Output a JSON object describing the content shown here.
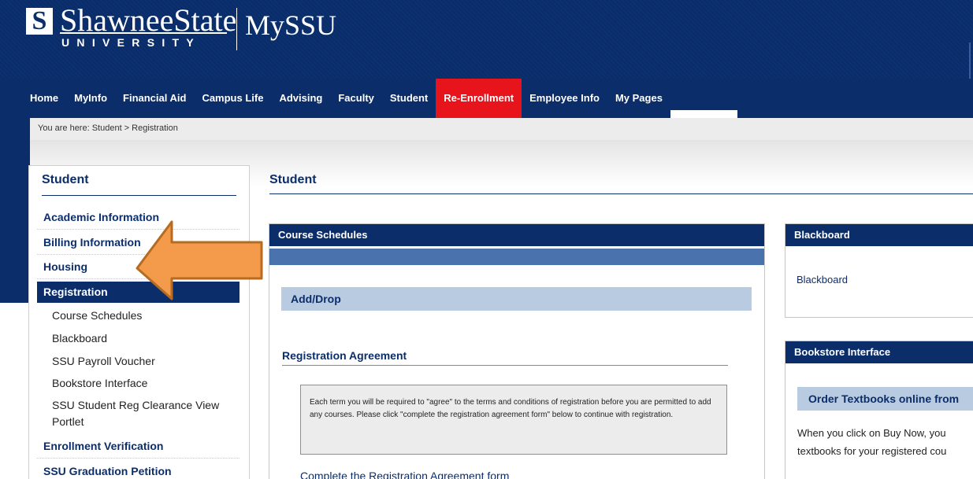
{
  "header": {
    "logo_mark": "S",
    "logo_name": "ShawneeState",
    "logo_sub": "UNIVERSITY",
    "app_title": "MySSU"
  },
  "nav": {
    "items": [
      "Home",
      "MyInfo",
      "Financial Aid",
      "Campus Life",
      "Advising",
      "Faculty",
      "Student",
      "Re-Enrollment",
      "Employee Info",
      "My Pages"
    ],
    "active_item": "Re-Enrollment",
    "active_color": "#e8141c"
  },
  "breadcrumb": {
    "text": "You are here:  Student > Registration"
  },
  "sidebar": {
    "title": "Student",
    "items": [
      {
        "label": "Academic Information"
      },
      {
        "label": "Billing Information"
      },
      {
        "label": "Housing"
      },
      {
        "label": "Registration",
        "selected": true
      },
      {
        "label": "Enrollment Verification"
      },
      {
        "label": "SSU Graduation Petition"
      }
    ],
    "sub_items": [
      "Course Schedules",
      "Blackboard",
      "SSU Payroll Voucher",
      "Bookstore Interface",
      "SSU Student Reg Clearance View",
      "Portlet"
    ]
  },
  "main": {
    "title": "Student",
    "course_schedules": {
      "header": "Course Schedules",
      "add_drop": "Add/Drop",
      "reg_agreement_title": "Registration Agreement",
      "reg_agreement_text": "Each term you will be required to \"agree\" to the terms and conditions of registration before you are permitted to add any courses.  Please click \"complete the registration agreement form\" below to continue with registration.",
      "complete_link": "Complete the Registration Agreement form"
    },
    "blackboard": {
      "header": "Blackboard",
      "link": "Blackboard"
    },
    "bookstore": {
      "header": "Bookstore Interface",
      "order_bar": "Order Textbooks online from",
      "text_line1": "When you click on Buy Now, you",
      "text_line2": "textbooks for your registered cou"
    }
  },
  "colors": {
    "brand_navy": "#0b2e6b",
    "arrow_orange": "#f39b4b"
  },
  "icons": {
    "pointer_arrow": "orange-left-arrow"
  }
}
